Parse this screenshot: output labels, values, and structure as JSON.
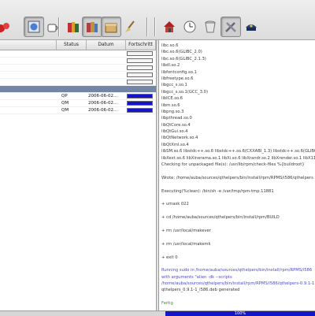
{
  "toolbar": {
    "buttons": [
      {
        "icon": "red-balls-icon",
        "pressed": false
      },
      {
        "icon": "globe-view-icon",
        "pressed": true
      },
      {
        "icon": "coffee-cup-icon",
        "pressed": false
      },
      {
        "icon": "books-icon",
        "pressed": false
      },
      {
        "icon": "copy-books-icon",
        "pressed": true
      },
      {
        "icon": "package-box-icon",
        "pressed": true
      },
      {
        "icon": "broom-icon",
        "pressed": false
      },
      {
        "icon": "house-red-icon",
        "pressed": false
      },
      {
        "icon": "clock-icon",
        "pressed": false
      },
      {
        "icon": "trash-can-icon",
        "pressed": false
      },
      {
        "icon": "tools-icon",
        "pressed": true
      },
      {
        "icon": "police-hat-icon",
        "pressed": false
      }
    ]
  },
  "table": {
    "headers": [
      "",
      "Status",
      "Datum",
      "Fortschritt"
    ],
    "rows": [
      {
        "name": "",
        "status": "",
        "date": "",
        "progress": 0,
        "kind": "group"
      },
      {
        "name": "",
        "status": "",
        "date": "",
        "progress": 0,
        "kind": "plain"
      },
      {
        "name": "",
        "status": "",
        "date": "",
        "progress": 0,
        "kind": "plain"
      },
      {
        "name": "",
        "status": "",
        "date": "",
        "progress": 0,
        "kind": "plain"
      },
      {
        "name": "",
        "status": "",
        "date": "",
        "progress": 0,
        "kind": "plain"
      },
      {
        "name": "",
        "status": "",
        "date": "",
        "progress": 0,
        "kind": "selected"
      },
      {
        "name": "",
        "status": "QP",
        "date": "2006-06-02...",
        "progress": 1.0,
        "kind": "plain"
      },
      {
        "name": "",
        "status": "QM",
        "date": "2006-06-02...",
        "progress": 1.0,
        "kind": "plain"
      },
      {
        "name": "",
        "status": "QM",
        "date": "2006-06-02...",
        "progress": 1.0,
        "kind": "plain"
      }
    ]
  },
  "log": [
    {
      "text": "libc.so.6",
      "style": ""
    },
    {
      "text": "libc.so.6(GLIBC_2.0)",
      "style": ""
    },
    {
      "text": "libc.so.6(GLIBC_2.1.3)",
      "style": ""
    },
    {
      "text": "libdl.so.2",
      "style": ""
    },
    {
      "text": "libfontconfig.so.1",
      "style": ""
    },
    {
      "text": "libfreetype.so.6",
      "style": ""
    },
    {
      "text": "libgcc_s.so.1",
      "style": ""
    },
    {
      "text": "libgcc_s.so.1(GCC_3.0)",
      "style": ""
    },
    {
      "text": "libICE.so.6",
      "style": ""
    },
    {
      "text": "libm.so.6",
      "style": ""
    },
    {
      "text": "libpng.so.3",
      "style": ""
    },
    {
      "text": "libpthread.so.0",
      "style": ""
    },
    {
      "text": "libQtCore.so.4",
      "style": ""
    },
    {
      "text": "libQtGui.so.4",
      "style": ""
    },
    {
      "text": "libQtNetwork.so.4",
      "style": ""
    },
    {
      "text": "libQtXml.so.4",
      "style": ""
    },
    {
      "text": "libSM.so.6 libstdc++.so.6 libstdc++.so.6(CXXABI_1.3) libstdc++.so.6(GLIBCXX",
      "style": ""
    },
    {
      "text": "libXext.so.6 libXinerama.so.1 libXi.so.6 libXrandr.so.2 libXrender.so.1 libX11",
      "style": ""
    },
    {
      "text": "Checking for unpackaged file(s): /usr/lib/rpm/check-files %{buildroot}",
      "style": ""
    },
    {
      "text": "",
      "style": "gap"
    },
    {
      "text": "Wrote: /home/auba/sources/qthelpers/bin/install/rpm/RPMS/i586/qthelpers",
      "style": ""
    },
    {
      "text": "",
      "style": "gap"
    },
    {
      "text": "Executing(%clean): /bin/sh -e /var/tmp/rpm-tmp.11881",
      "style": ""
    },
    {
      "text": "",
      "style": "gap"
    },
    {
      "text": "+ umask 022",
      "style": ""
    },
    {
      "text": "",
      "style": "gap"
    },
    {
      "text": "+ cd /home/auba/sources/qthelpers/bin/install/rpm/BUILD",
      "style": ""
    },
    {
      "text": "",
      "style": "gap"
    },
    {
      "text": "+ rm /usr/local/makever",
      "style": ""
    },
    {
      "text": "",
      "style": "gap"
    },
    {
      "text": "+ rm /usr/local/makemk",
      "style": ""
    },
    {
      "text": "",
      "style": "gap"
    },
    {
      "text": "+ exit 0",
      "style": ""
    },
    {
      "text": "",
      "style": "gap"
    },
    {
      "text": "Running sudo in /home/auba/sources/qthelpers/bin/install/rpm/RPMS/i586",
      "style": "blue"
    },
    {
      "text": "with arguments \"alien -dk --scripts",
      "style": "blue"
    },
    {
      "text": "/home/auba/sources/qthelpers/bin/install/rpm/RPMS/i586/qthelpers-0.9.1-1",
      "style": "blue"
    },
    {
      "text": "qthelpers_0.9.1-1_i586.deb generated",
      "style": ""
    },
    {
      "text": "",
      "style": "gap"
    },
    {
      "text": "Fertig",
      "style": "green"
    }
  ],
  "statusbar": {
    "progress_label": "100%",
    "progress": 1.0
  }
}
